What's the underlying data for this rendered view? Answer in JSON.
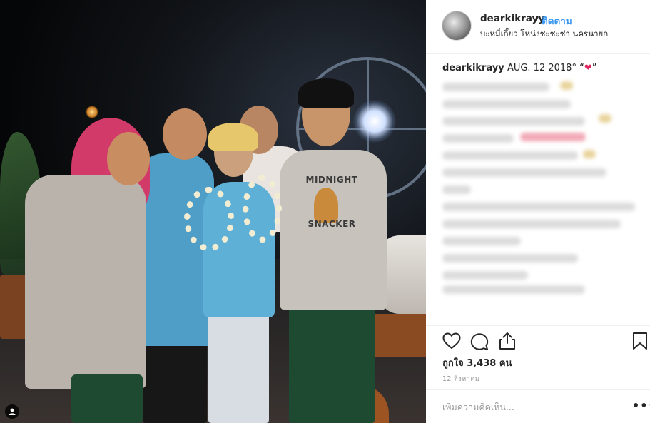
{
  "post": {
    "photo_text": {
      "shirt_line1": "MIDNIGHT",
      "shirt_line2": "SNACKER"
    }
  },
  "header": {
    "username": "dearkikrayy",
    "separator": "•",
    "follow_label": "ติดตาม",
    "location": "บะหมี่เกี๊ยว โหน่งชะชะช่า นครนายก"
  },
  "caption": {
    "username": "dearkikrayy",
    "text": "AUG. 12 2018° “",
    "emoji": "❤",
    "close_quote": "”"
  },
  "engagement": {
    "likes_label": "ถูกใจ 3,438 คน",
    "date": "12 สิงหาคม"
  },
  "comment": {
    "placeholder": "เพิ่มความคิดเห็น...",
    "more_label": "•••"
  },
  "icons": {
    "like": "heart-outline-icon",
    "comment": "speech-bubble-icon",
    "share": "share-icon",
    "save": "bookmark-icon",
    "tag": "user-tag-icon"
  },
  "colors": {
    "link_blue": "#3897f0",
    "text": "#262626",
    "muted": "#999999",
    "heart": "#e0245e"
  }
}
